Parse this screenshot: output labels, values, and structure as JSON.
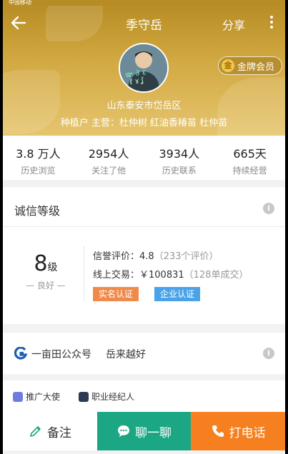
{
  "status_bar": {
    "carrier": "中国移动"
  },
  "header": {
    "title": "季守岳",
    "share_label": "分享",
    "badge_label": "金牌会员",
    "badge_coin": "金",
    "location": "山东泰安市岱岳区",
    "crops": "种植户  主营：杜仲树 红油香椿苗 杜仲苗"
  },
  "stats": [
    {
      "value": "3.8 万人",
      "label": "历史浏览"
    },
    {
      "value": "2954人",
      "label": "关注了他"
    },
    {
      "value": "3934人",
      "label": "历史联系"
    },
    {
      "value": "665天",
      "label": "持续经营"
    }
  ],
  "credit": {
    "title": "诚信等级",
    "level": "8",
    "level_unit": "级",
    "level_word": "— 良好 —",
    "reputation_label": "信誉评价：4.8",
    "reputation_count": "（233个评价）",
    "trade_label": "线上交易：￥100831",
    "trade_count": "（128单成交）",
    "tag_real": "实名认证",
    "tag_biz": "企业认证"
  },
  "wechat": {
    "name": "一亩田公众号",
    "slogan": "岳来越好"
  },
  "roles": {
    "promoter": "推广大使",
    "agent": "职业经纪人"
  },
  "bottom": {
    "note": "备注",
    "chat": "聊一聊",
    "call": "打电话"
  },
  "colors": {
    "header_gold": "#c99f3a",
    "chat_green": "#1ba784",
    "call_orange": "#f6801f",
    "tag_orange": "#f08a4b",
    "tag_blue": "#4aa3e8"
  }
}
